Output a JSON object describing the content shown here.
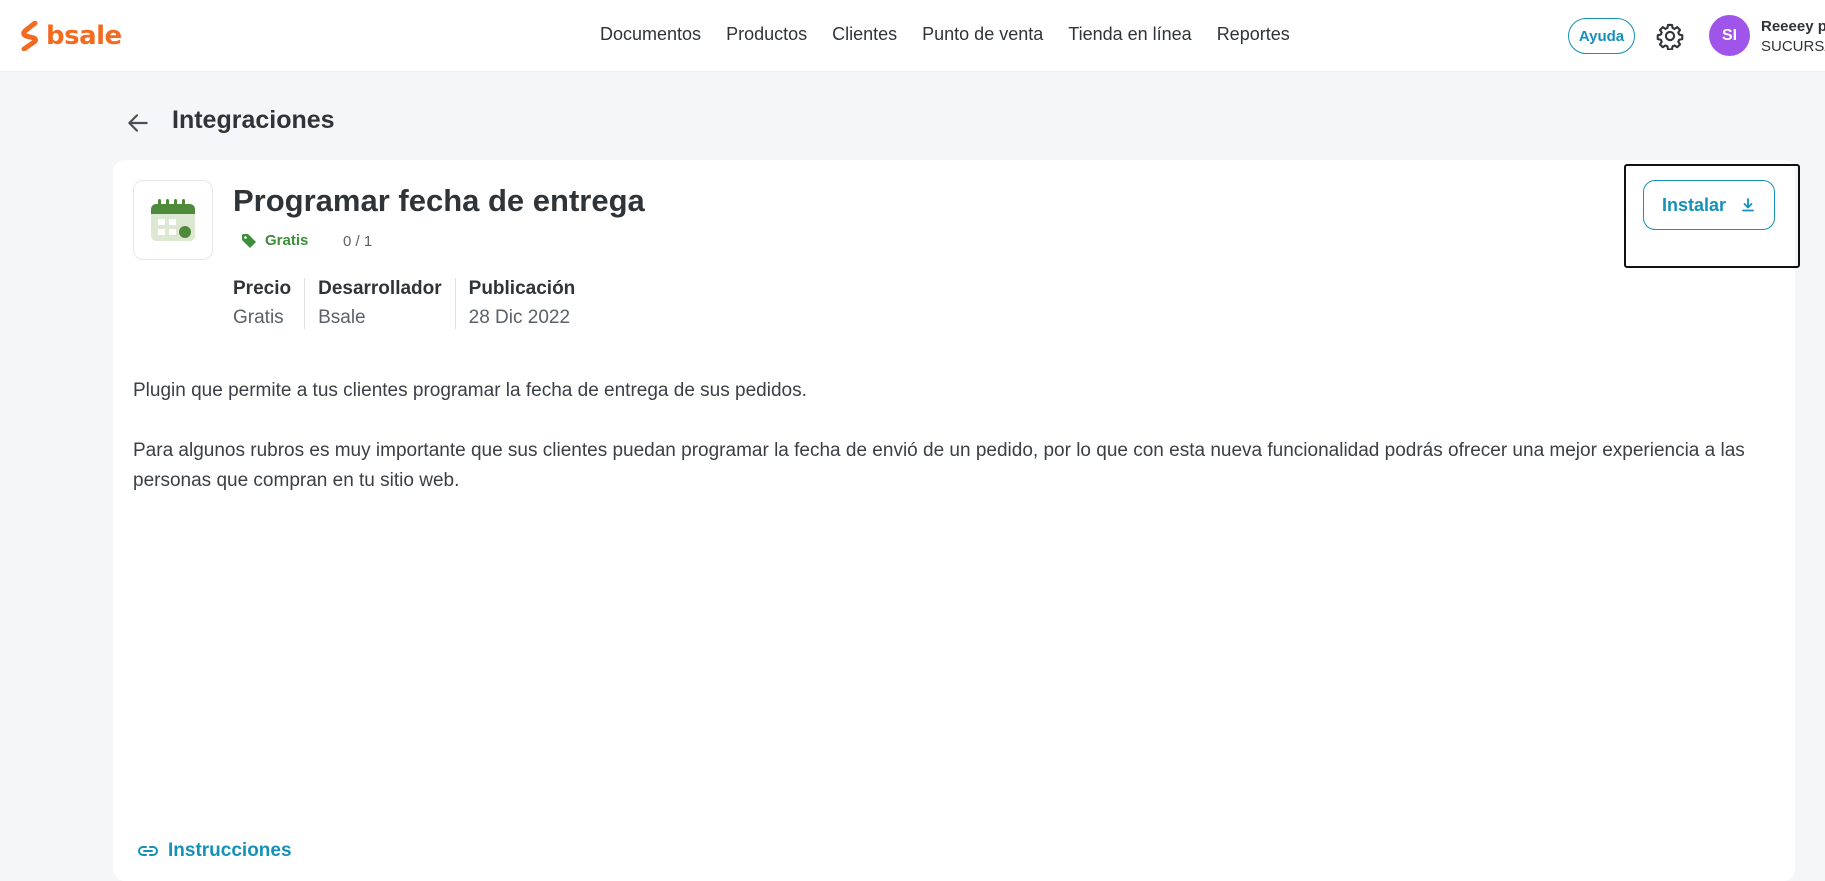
{
  "brand": {
    "name": "bsale",
    "color": "#f26b21"
  },
  "nav": {
    "items": [
      "Documentos",
      "Productos",
      "Clientes",
      "Punto de venta",
      "Tienda en línea",
      "Reportes"
    ]
  },
  "header": {
    "help_label": "Ayuda",
    "avatar_initials": "SI",
    "user_name": "Reeeey p",
    "user_branch": "SUCURSA"
  },
  "page": {
    "title": "Integraciones"
  },
  "app": {
    "title": "Programar fecha de entrega",
    "price_badge": "Gratis",
    "installs": "0 / 1",
    "install_label": "Instalar",
    "meta": [
      {
        "label": "Precio",
        "value": "Gratis"
      },
      {
        "label": "Desarrollador",
        "value": "Bsale"
      },
      {
        "label": "Publicación",
        "value": "28 Dic 2022"
      }
    ],
    "description": [
      "Plugin que permite a tus clientes programar la fecha de entrega de sus pedidos.",
      "Para algunos rubros es muy importante que sus clientes puedan programar la fecha de envió de un pedido, por lo que con esta nueva funcionalidad podrás ofrecer una mejor experiencia a las personas que compran en tu sitio web."
    ],
    "instructions_label": "Instrucciones"
  },
  "colors": {
    "accent": "#1591b8",
    "badge_green": "#3b8f3b",
    "avatar": "#9f55ea"
  },
  "icons": [
    "bsale-logo",
    "back-arrow-icon",
    "gear-icon",
    "calendar-icon",
    "tag-icon",
    "download-icon",
    "link-icon"
  ]
}
